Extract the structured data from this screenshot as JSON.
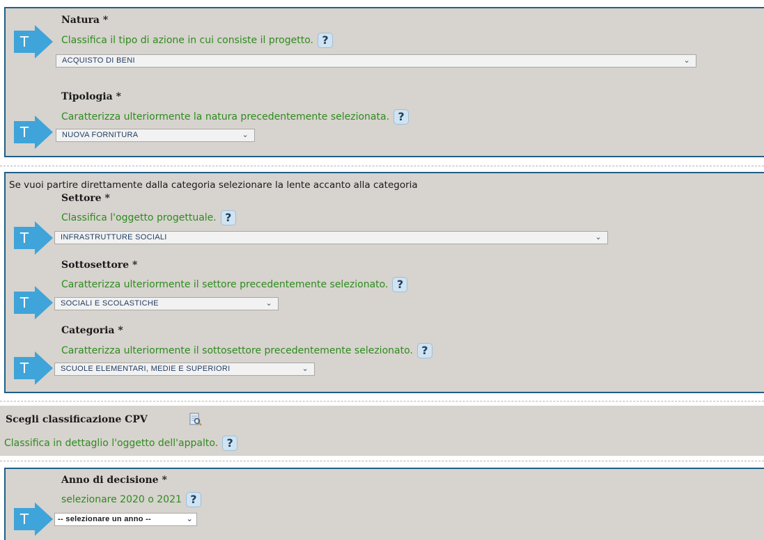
{
  "section1": {
    "natura": {
      "label": "Natura *",
      "hint": "Classifica il tipo di azione in cui consiste il progetto.",
      "value": "ACQUISTO DI BENI"
    },
    "tipologia": {
      "label": "Tipologia *",
      "hint": "Caratterizza ulteriormente la natura precedentemente selezionata.",
      "value": "NUOVA FORNITURA"
    }
  },
  "section2": {
    "intro": "Se vuoi partire direttamente dalla categoria selezionare la lente accanto alla categoria",
    "settore": {
      "label": "Settore *",
      "hint": "Classifica l'oggetto progettuale.",
      "value": "INFRASTRUTTURE SOCIALI"
    },
    "sottosettore": {
      "label": "Sottosettore *",
      "hint": "Caratterizza ulteriormente il settore precedentemente selezionato.",
      "value": "SOCIALI E SCOLASTICHE"
    },
    "categoria": {
      "label": "Categoria *",
      "hint": "Caratterizza ulteriormente il sottosettore precedentemente selezionato.",
      "value": "SCUOLE ELEMENTARI, MEDIE E SUPERIORI"
    }
  },
  "cpv": {
    "title": "Scegli classificazione CPV",
    "hint": "Classifica in dettaglio l'oggetto dell'appalto.",
    "icon": "search-document-icon"
  },
  "section3": {
    "anno": {
      "label": "Anno di decisione *",
      "hint": "selezionare 2020 o 2021",
      "value": "-- selezionare un anno --"
    }
  },
  "common": {
    "help_glyph": "?",
    "chevron_glyph": "⌄",
    "arrow_letter": "T",
    "colors": {
      "panel_bg": "#d7d3ce",
      "panel_border": "#1f5f86",
      "hint_green": "#2e8b1f",
      "arrow_blue": "#3fa4d9"
    }
  }
}
